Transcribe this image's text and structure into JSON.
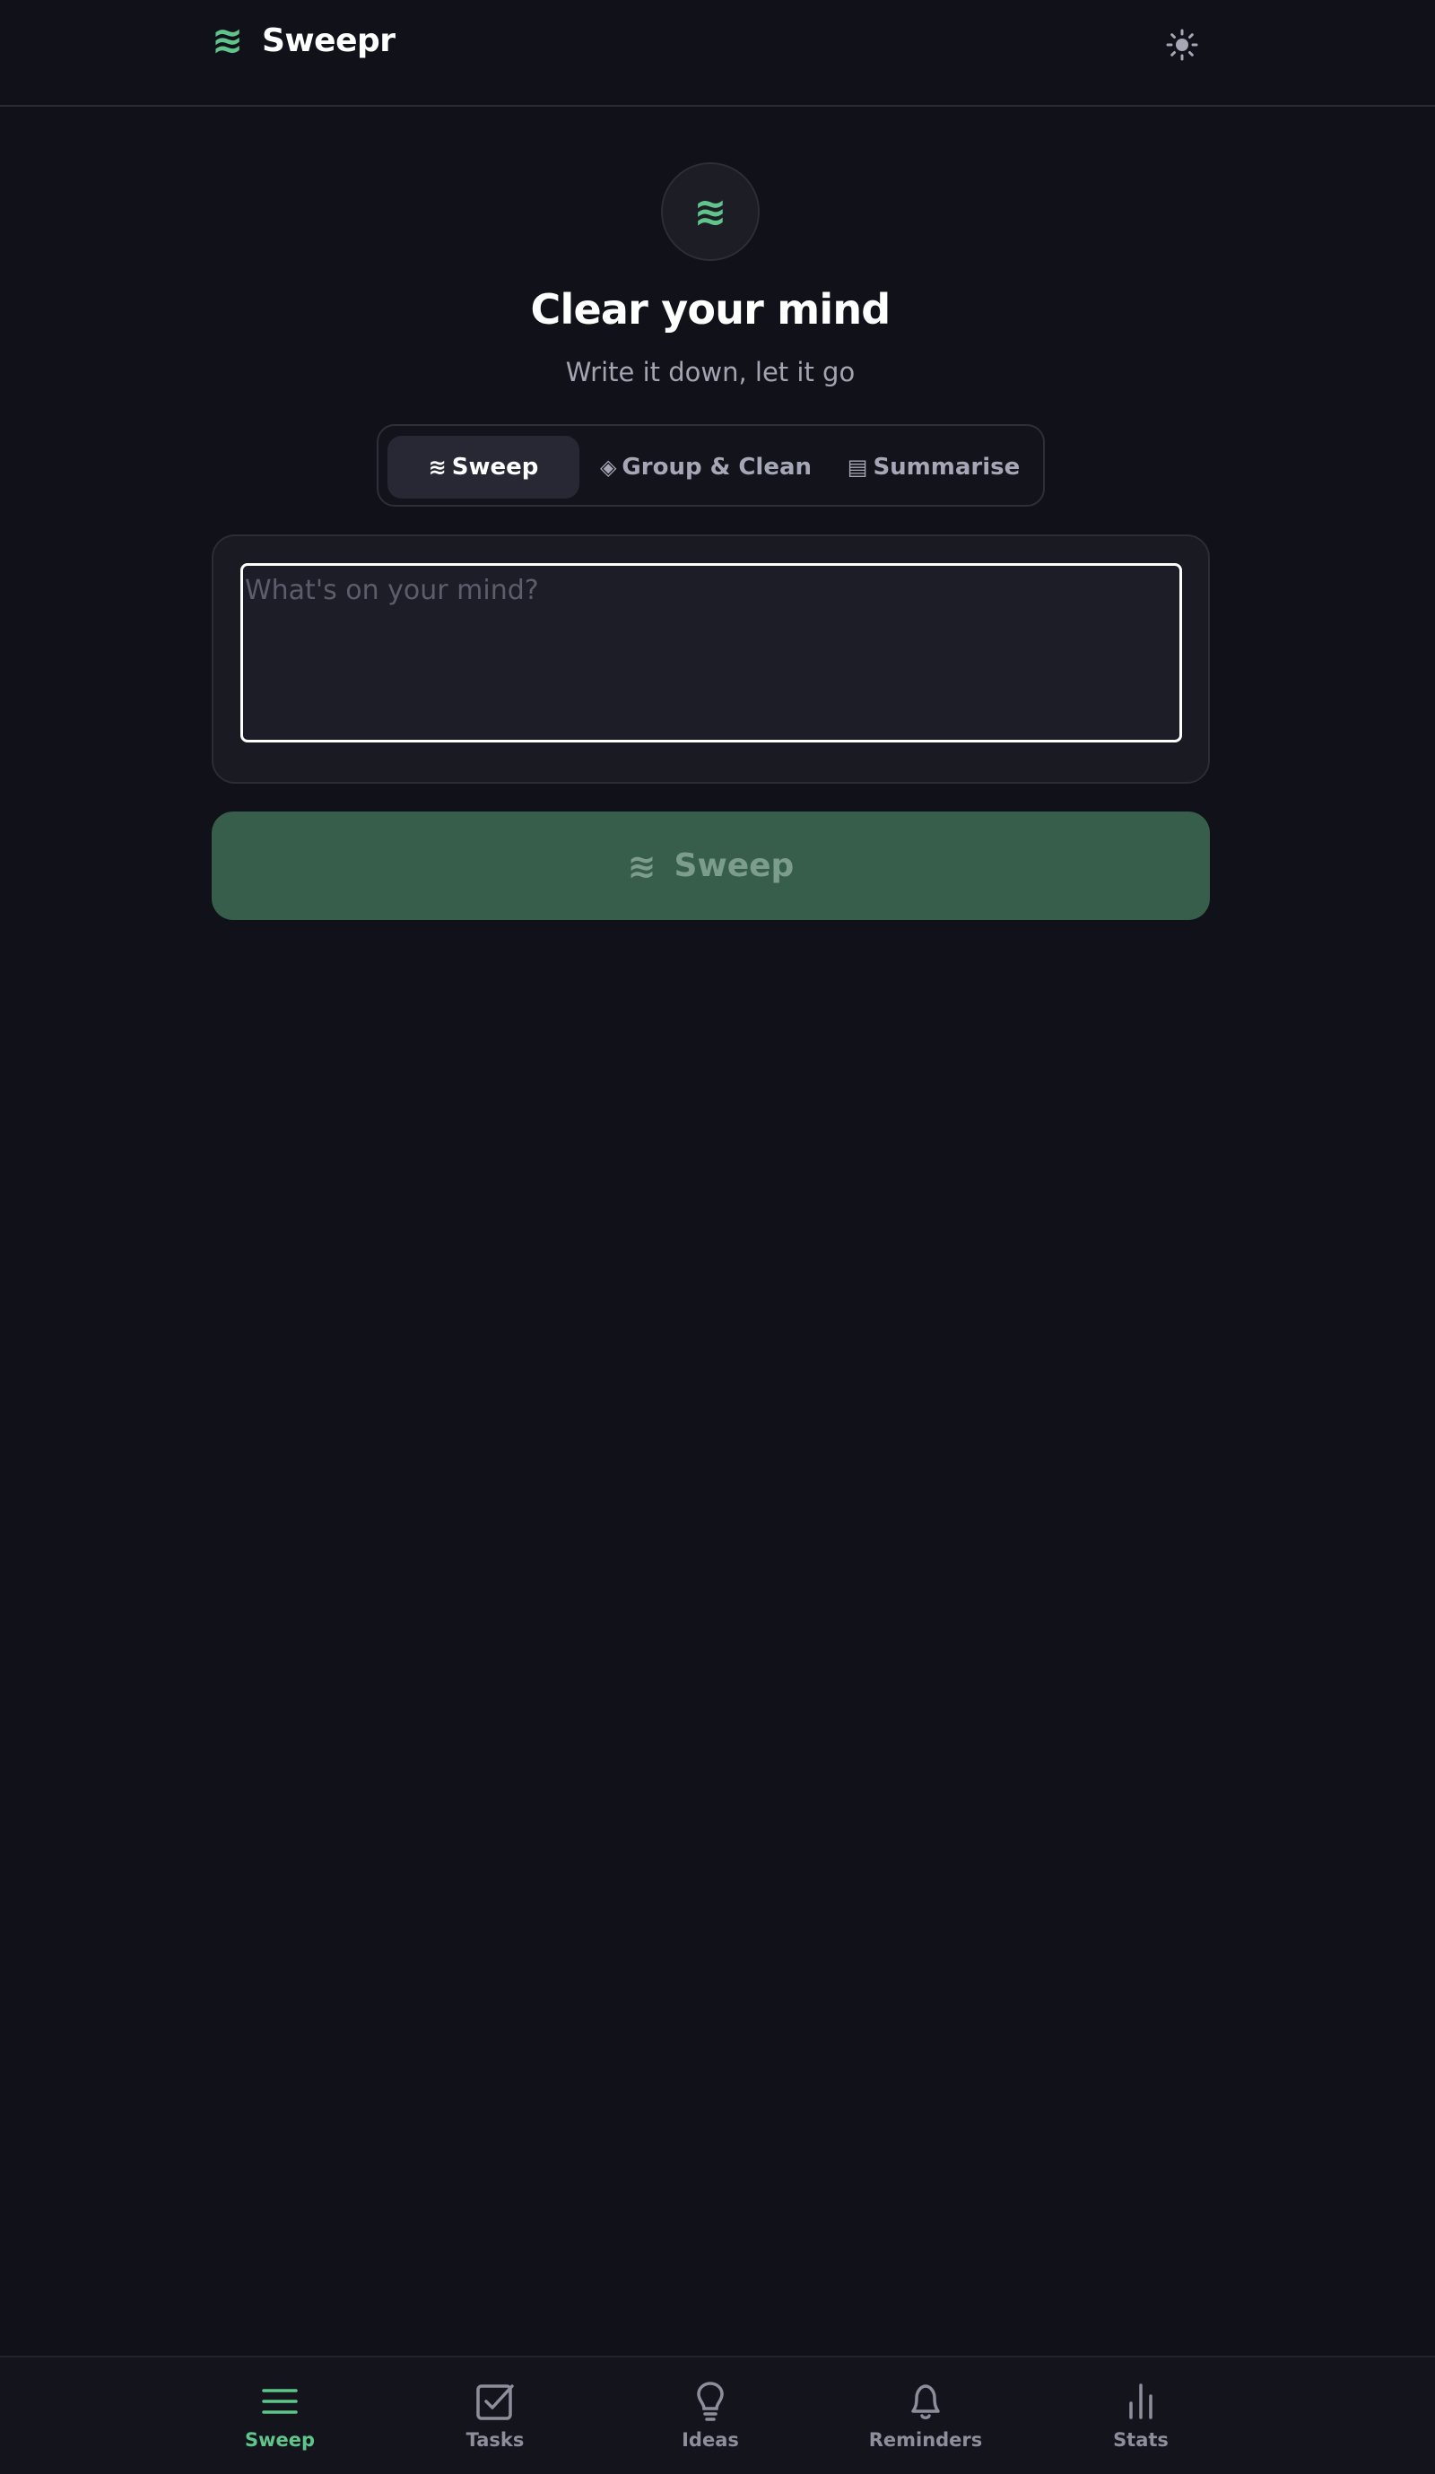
{
  "header": {
    "brand_icon": "≋",
    "brand_name": "Sweepr",
    "theme_toggle_icon": "sun-icon"
  },
  "hero": {
    "logo_icon": "≋",
    "title": "Clear your mind",
    "subtitle": "Write it down, let it go"
  },
  "mode_tabs": [
    {
      "icon": "≋",
      "label": "Sweep",
      "active": true
    },
    {
      "icon": "◈",
      "label": "Group & Clean",
      "active": false
    },
    {
      "icon": "▤",
      "label": "Summarise",
      "active": false
    }
  ],
  "input": {
    "placeholder": "What's on your mind?",
    "value": ""
  },
  "sweep_button": {
    "icon": "≋",
    "label": "Sweep"
  },
  "bottom_nav": [
    {
      "label": "Sweep",
      "icon": "menu-lines-icon",
      "active": true
    },
    {
      "label": "Tasks",
      "icon": "checkbox-icon",
      "active": false
    },
    {
      "label": "Ideas",
      "icon": "lightbulb-icon",
      "active": false
    },
    {
      "label": "Reminders",
      "icon": "bell-icon",
      "active": false
    },
    {
      "label": "Stats",
      "icon": "bar-chart-icon",
      "active": false
    }
  ],
  "colors": {
    "background": "#111219",
    "accent": "#5fc58a",
    "button": "#375e4b",
    "muted_text": "#a3a4b2",
    "nav_inactive": "#8d8e9c"
  }
}
